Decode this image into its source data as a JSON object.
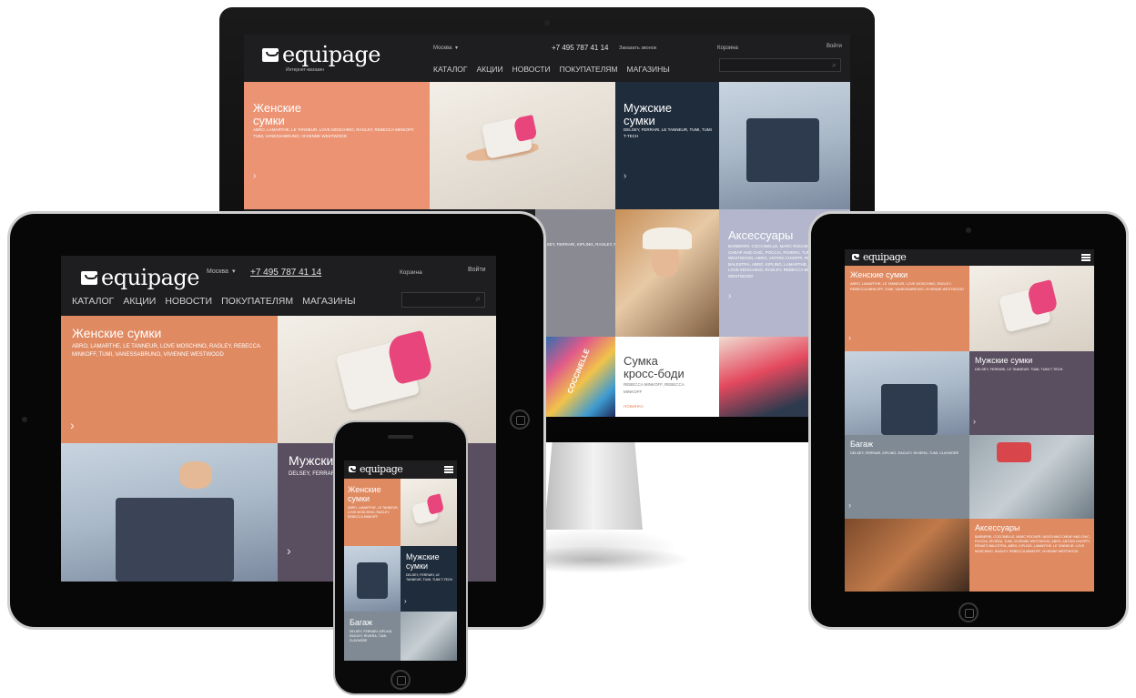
{
  "brand": {
    "logo_text": "equipage",
    "tagline": "Интернет-магазин"
  },
  "header": {
    "city": "Москва",
    "phone": "+7 495 787 41 14",
    "callback": "Заказать звонок",
    "cart": "Корзина",
    "login": "Войти",
    "city_chevron": "▾",
    "search_icon": "⌕"
  },
  "nav": [
    "КАТАЛОГ",
    "АКЦИИ",
    "НОВОСТИ",
    "ПОКУПАТЕЛЯМ",
    "МАГАЗИНЫ"
  ],
  "tiles": {
    "women": {
      "title1": "Женские",
      "title2": "сумки",
      "title_one": "Женские сумки",
      "brands": "ABRO, LAMARTHE, LE TANNEUR, LOVE MOSCHINO, RAGLEY, REBECCA MINKOFF, TUMI, VANESSABRUNO, VIVIENNE WESTWOOD"
    },
    "men": {
      "title1": "Мужские",
      "title2": "сумки",
      "title_one": "Мужские сумки",
      "brands": "DELSEY, FERRARI, LE TANNEUR, TUMI, TUMI T-TECH"
    },
    "luggage": {
      "title": "Багаж",
      "brands": "DELSEY, FERRARI, KIPLING, RAGLEY, RIVIERA, TUMI, CLAYMORE"
    },
    "accessories": {
      "title": "Аксессуары",
      "brands": "BARBERRI, COCCINELLE, MARC ROCHER, MOSCHINO CHEAP AND CHIC, POCCIA, RIVIERA, TUMI, VIVIENNE WESTWOOD, ABRO, ANTONI CHIOPPI, RENATO BALESTRA, ABRO, KIPLING, LAMARTHE, LE TANNEUR, LOVE MOSCHINO, RAGLEY, REBECCA MINKOFF, VIVIENNE WESTWOOD"
    },
    "crossbody": {
      "title1": "Сумка",
      "title2": "кросс-боди",
      "brand": "REBECCA MINKOFF, REBECCA",
      "brand2": "MINKOFF",
      "label": "НОВИНКА"
    },
    "scarf_label": "COCCINELLE"
  },
  "phone_tiles": {
    "women_brands": "ABRO, LAMARTHE, LE TANNEUR, LOVE MOSCHINO, RAGLEY, REBECCA MINKOFF",
    "men_brands": "DELSEY, FERRARI, LE TANNEUR, TUMI, TUMI T-TECH",
    "luggage_brands": "DELSEY, FERRARI, KIPLING, RAGLEY, RIVIERA, TUMI, CLAYMORE"
  },
  "arrow": "›",
  "menu_icon": "menu-icon",
  "colors": {
    "salmon": "#ec9373",
    "dark_navy": "#1f2c3c",
    "mauve": "#5a4f60",
    "grey": "#7f8a95",
    "lilac": "#b3b6cc",
    "orange_tile": "#e08a62",
    "header": "#1e1e20"
  }
}
